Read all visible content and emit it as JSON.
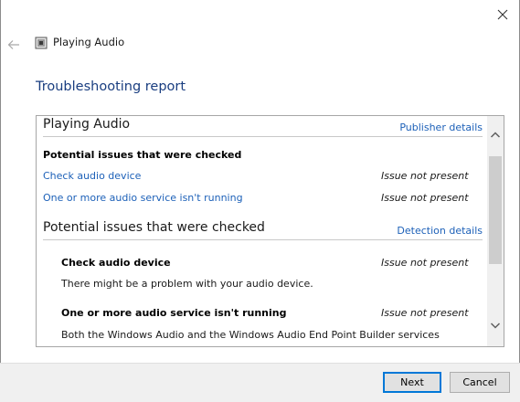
{
  "window": {
    "title": "Playing Audio"
  },
  "heading": "Troubleshooting report",
  "report": {
    "summary": {
      "title": "Playing Audio",
      "link": "Publisher details",
      "checked_label": "Potential issues that were checked",
      "items": [
        {
          "label": "Check audio device",
          "status": "Issue not present"
        },
        {
          "label": "One or more audio service isn't running",
          "status": "Issue not present"
        }
      ]
    },
    "details": {
      "title": "Potential issues that were checked",
      "link": "Detection details",
      "items": [
        {
          "label": "Check audio device",
          "status": "Issue not present",
          "description": "There might be a problem with your audio device."
        },
        {
          "label": "One or more audio service isn't running",
          "status": "Issue not present",
          "description": "Both the Windows Audio and the Windows Audio End Point Builder services"
        }
      ]
    }
  },
  "footer": {
    "next_label": "Next",
    "cancel_label": "Cancel"
  },
  "colors": {
    "link": "#1c60b8",
    "heading": "#1a3e80",
    "accent": "#0078d7"
  },
  "icons": {
    "close": "close-icon",
    "back": "back-arrow-icon",
    "app": "troubleshooter-app-icon",
    "scroll_up": "chevron-up-icon",
    "scroll_down": "chevron-down-icon"
  }
}
